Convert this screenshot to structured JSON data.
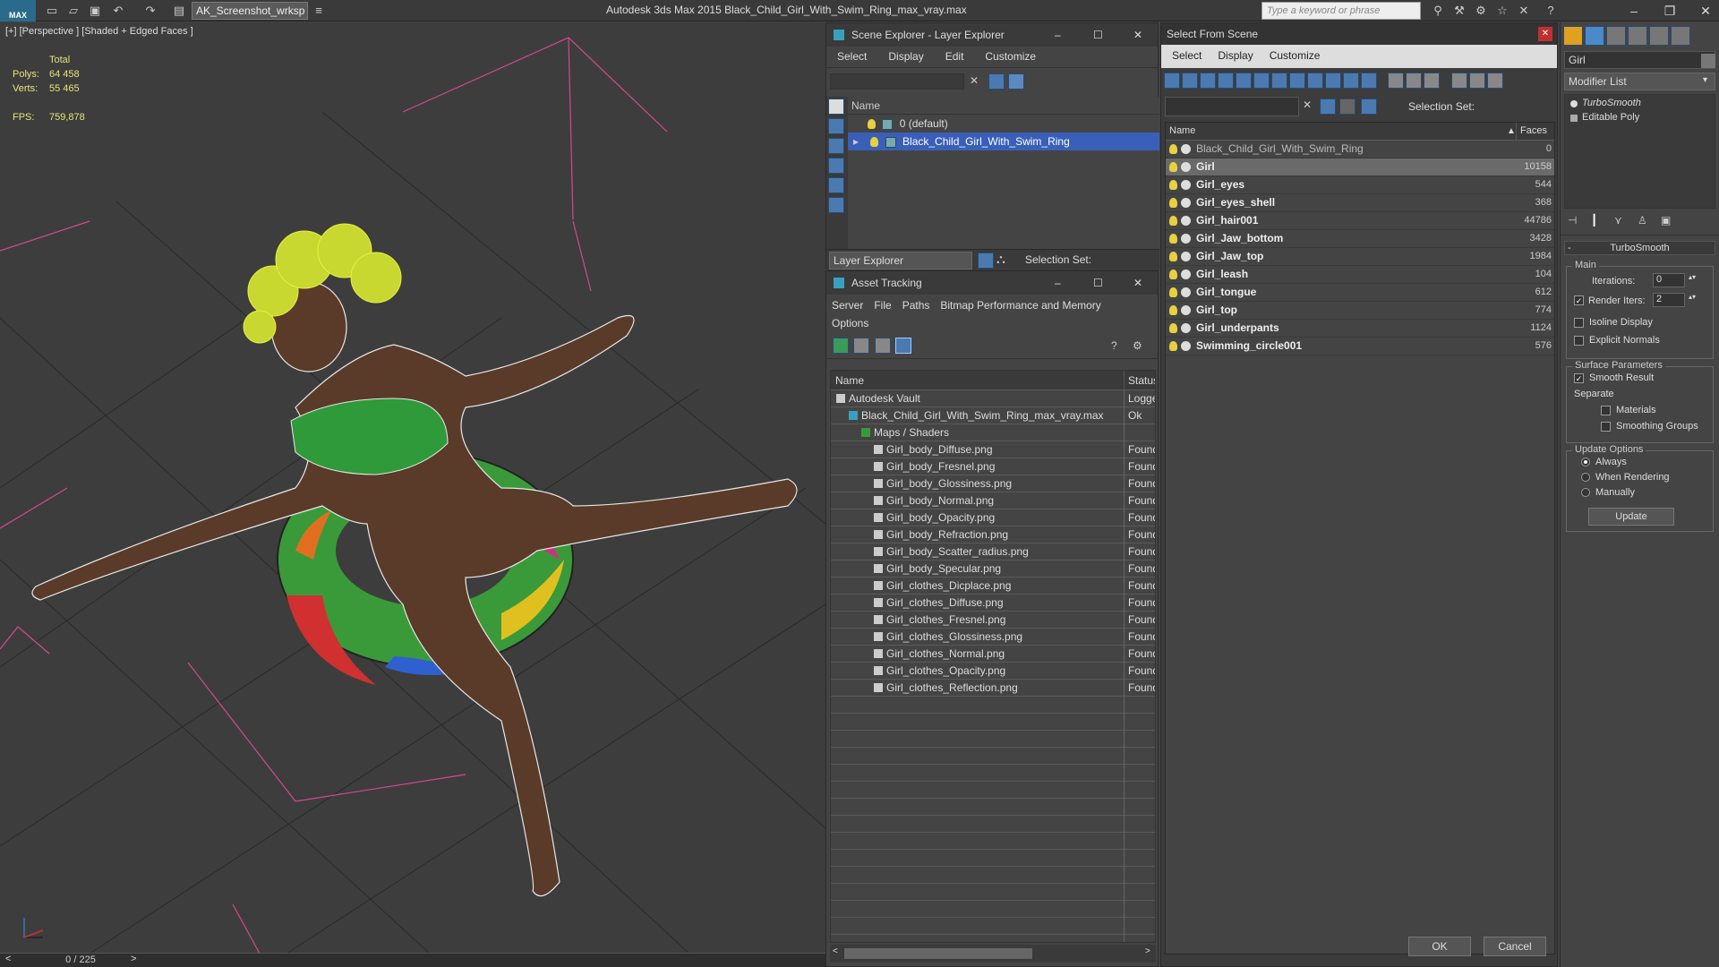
{
  "app": {
    "workspace": "AK_Screenshot_wrksp",
    "title": "Autodesk 3ds Max  2015    Black_Child_Girl_With_Swim_Ring_max_vray.max",
    "search_placeholder": "Type a keyword or phrase"
  },
  "viewport": {
    "label": "[+] [Perspective ] [Shaded + Edged Faces ]",
    "stats_header": "Total",
    "polys_label": "Polys:",
    "polys_value": "64 458",
    "verts_label": "Verts:",
    "verts_value": "55 465",
    "fps_label": "FPS:",
    "fps_value": "759,878",
    "frame": "0 / 225"
  },
  "scene_explorer": {
    "title": "Scene Explorer - Layer Explorer",
    "menu": [
      "Select",
      "Display",
      "Edit",
      "Customize"
    ],
    "col_name": "Name",
    "rows": [
      "0 (default)",
      "Black_Child_Girl_With_Swim_Ring"
    ],
    "bottom_label": "Layer Explorer",
    "selection_set_label": "Selection Set:"
  },
  "asset_tracking": {
    "title": "Asset Tracking",
    "menu": [
      "Server",
      "File",
      "Paths",
      "Bitmap Performance and Memory",
      "Options"
    ],
    "col_name": "Name",
    "col_status": "Status",
    "rows": [
      {
        "name": "Autodesk Vault",
        "status": "Logged"
      },
      {
        "name": "Black_Child_Girl_With_Swim_Ring_max_vray.max",
        "status": "Ok"
      },
      {
        "name": "Maps / Shaders",
        "status": ""
      },
      {
        "name": "Girl_body_Diffuse.png",
        "status": "Found"
      },
      {
        "name": "Girl_body_Fresnel.png",
        "status": "Found"
      },
      {
        "name": "Girl_body_Glossiness.png",
        "status": "Found"
      },
      {
        "name": "Girl_body_Normal.png",
        "status": "Found"
      },
      {
        "name": "Girl_body_Opacity.png",
        "status": "Found"
      },
      {
        "name": "Girl_body_Refraction.png",
        "status": "Found"
      },
      {
        "name": "Girl_body_Scatter_radius.png",
        "status": "Found"
      },
      {
        "name": "Girl_body_Specular.png",
        "status": "Found"
      },
      {
        "name": "Girl_clothes_Dicplace.png",
        "status": "Found"
      },
      {
        "name": "Girl_clothes_Diffuse.png",
        "status": "Found"
      },
      {
        "name": "Girl_clothes_Fresnel.png",
        "status": "Found"
      },
      {
        "name": "Girl_clothes_Glossiness.png",
        "status": "Found"
      },
      {
        "name": "Girl_clothes_Normal.png",
        "status": "Found"
      },
      {
        "name": "Girl_clothes_Opacity.png",
        "status": "Found"
      },
      {
        "name": "Girl_clothes_Reflection.png",
        "status": "Found"
      }
    ]
  },
  "select_from_scene": {
    "title": "Select From Scene",
    "menu": [
      "Select",
      "Display",
      "Customize"
    ],
    "selection_set_label": "Selection Set:",
    "col_name": "Name",
    "col_faces": "Faces",
    "rows": [
      {
        "name": "Black_Child_Girl_With_Swim_Ring",
        "faces": "0"
      },
      {
        "name": "Girl",
        "faces": "10158"
      },
      {
        "name": "Girl_eyes",
        "faces": "544"
      },
      {
        "name": "Girl_eyes_shell",
        "faces": "368"
      },
      {
        "name": "Girl_hair001",
        "faces": "44786"
      },
      {
        "name": "Girl_Jaw_bottom",
        "faces": "3428"
      },
      {
        "name": "Girl_Jaw_top",
        "faces": "1984"
      },
      {
        "name": "Girl_leash",
        "faces": "104"
      },
      {
        "name": "Girl_tongue",
        "faces": "612"
      },
      {
        "name": "Girl_top",
        "faces": "774"
      },
      {
        "name": "Girl_underpants",
        "faces": "1124"
      },
      {
        "name": "Swimming_circle001",
        "faces": "576"
      }
    ],
    "ok": "OK",
    "cancel": "Cancel"
  },
  "modify_panel": {
    "object_name": "Girl",
    "modifier_list": "Modifier List",
    "stack": [
      "TurboSmooth",
      "Editable Poly"
    ],
    "rollout_title": "TurboSmooth",
    "main_label": "Main",
    "iterations_label": "Iterations:",
    "iterations_value": "0",
    "render_iters_label": "Render Iters:",
    "render_iters_value": "2",
    "isoline": "Isoline Display",
    "explicit": "Explicit Normals",
    "surface_params": "Surface Parameters",
    "smooth_result": "Smooth Result",
    "separate": "Separate",
    "materials": "Materials",
    "smoothing_groups": "Smoothing Groups",
    "update_options": "Update Options",
    "always": "Always",
    "when_rendering": "When Rendering",
    "manually": "Manually",
    "update": "Update"
  }
}
